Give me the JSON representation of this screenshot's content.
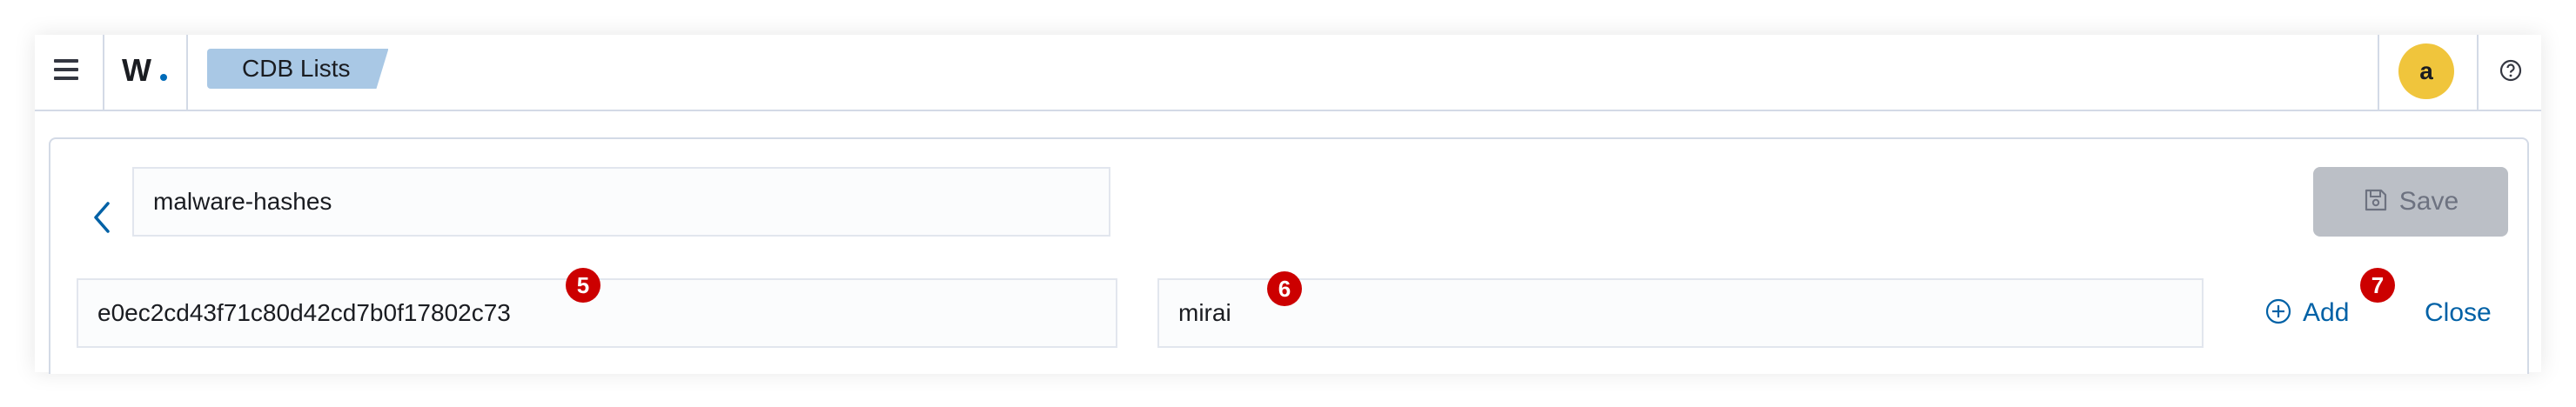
{
  "header": {
    "logo_text": "W.",
    "breadcrumb": "CDB Lists",
    "avatar_initial": "a",
    "brand_color": "#006bb8"
  },
  "editor": {
    "list_name": "malware-hashes",
    "save_label": "Save",
    "key_value": "e0ec2cd43f71c80d42cd7b0f17802c73",
    "value_value": "mirai",
    "add_label": "Add",
    "close_label": "Close"
  },
  "markers": {
    "key_marker": "5",
    "value_marker": "6",
    "add_marker": "7"
  },
  "icons": [
    "menu-icon",
    "help-icon",
    "back-arrow-icon",
    "save-icon",
    "plus-circle-icon"
  ]
}
